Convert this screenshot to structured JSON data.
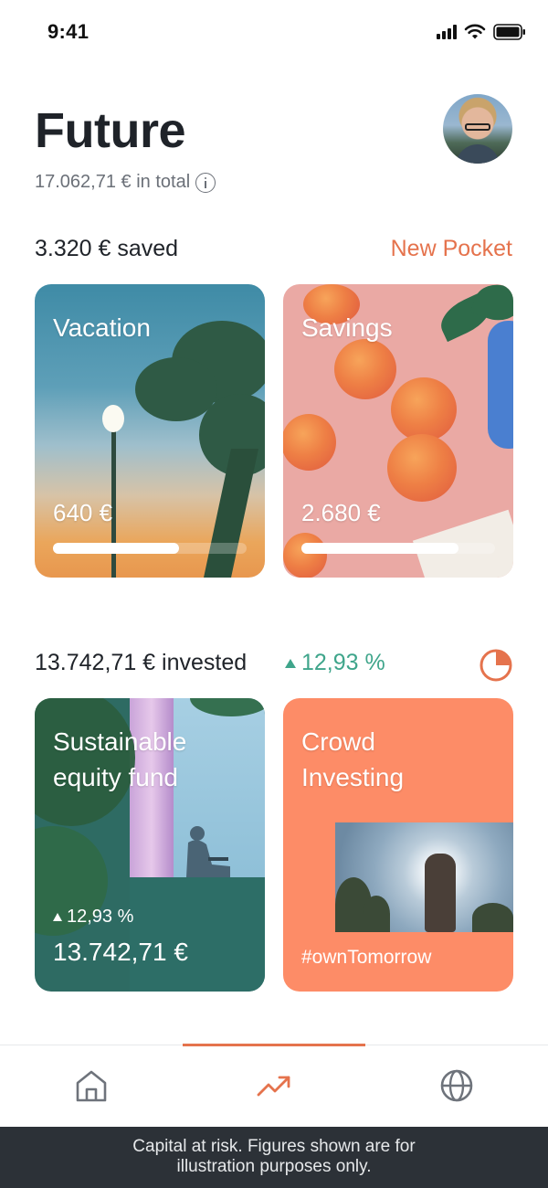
{
  "status_bar": {
    "time": "9:41"
  },
  "header": {
    "title": "Future",
    "total": "17.062,71 € in total"
  },
  "pockets": {
    "heading": "3.320 € saved",
    "new_pocket_label": "New Pocket",
    "items": [
      {
        "title": "Vacation",
        "amount": "640 €",
        "progress": 0.65
      },
      {
        "title": "Savings",
        "amount": "2.680 €",
        "progress": 0.81
      }
    ]
  },
  "investments": {
    "heading": "13.742,71 € invested",
    "performance": "12,93 %",
    "performance_color": "#3fa58b",
    "items": [
      {
        "title_line1": "Sustainable",
        "title_line2": "equity fund",
        "performance": "12,93 %",
        "amount": "13.742,71 €"
      },
      {
        "title_line1": "Crowd",
        "title_line2": "Investing",
        "tag": "#ownTomorrow"
      }
    ]
  },
  "bottom_nav": {
    "items": [
      {
        "icon": "home-icon",
        "active": false
      },
      {
        "icon": "trending-up-icon",
        "active": true
      },
      {
        "icon": "globe-icon",
        "active": false
      }
    ]
  },
  "disclaimer": {
    "line1": "Capital at risk. Figures shown are for",
    "line2": "illustration purposes only."
  },
  "colors": {
    "accent": "#e5734d",
    "positive": "#3fa58b",
    "crowd_card": "#fd8c67",
    "footer_bg": "#2c3137"
  }
}
